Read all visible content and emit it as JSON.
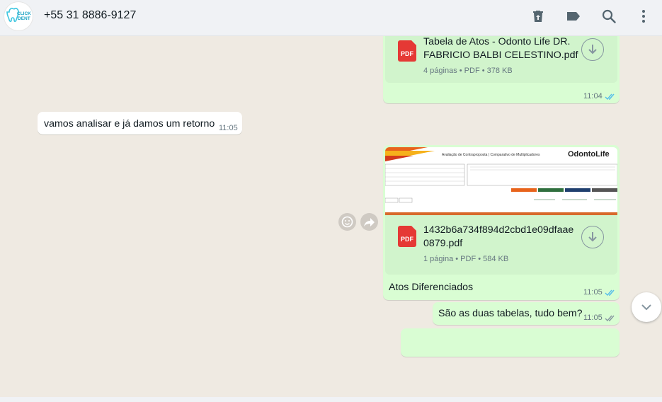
{
  "header": {
    "contact_name": "+55 31 8886-9127",
    "avatar_text_1": "CLICK",
    "avatar_text_2": "DENT"
  },
  "messages": {
    "m1": {
      "file_name_line1": "Tabela de Atos - Odonto Life DR.",
      "file_name_line2": "FABRICIO BALBI CELESTINO.pdf",
      "meta": "4 páginas • PDF • 378 KB",
      "time": "11:04"
    },
    "m2": {
      "text": "vamos analisar e já damos um retorno",
      "time": "11:05"
    },
    "m3": {
      "preview_title": "Avaliação de Contraproposta | Comparativo de Multiplicadores",
      "preview_brand": "OdontoLife",
      "file_name_line1": "1432b6a734f894d2cbd1e09dfaae",
      "file_name_line2": "0879.pdf",
      "meta": "1 página • PDF • 584 KB",
      "caption": "Atos Diferenciados",
      "time": "11:05"
    },
    "m4": {
      "text": "São as duas tabelas, tudo bem?",
      "time": "11:05"
    }
  },
  "pdf_label": "PDF",
  "colors": {
    "outgoing_bubble": "#d9fdd3",
    "incoming_bubble": "#ffffff",
    "read_ticks": "#53bdeb",
    "pdf_red": "#e53935"
  }
}
